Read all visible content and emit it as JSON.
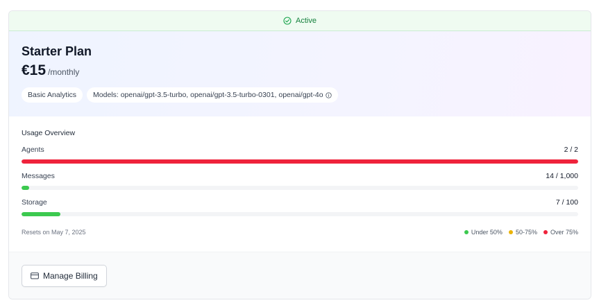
{
  "status": {
    "label": "Active",
    "icon": "check-circle-icon",
    "color": "#16a34a"
  },
  "plan": {
    "name": "Starter Plan",
    "price": "€15",
    "period": "/monthly",
    "features": [
      {
        "label": "Basic Analytics"
      },
      {
        "label": "Models: openai/gpt-3.5-turbo, openai/gpt-3.5-turbo-0301, openai/gpt-4o",
        "icon": "info-icon"
      }
    ]
  },
  "usage": {
    "title": "Usage Overview",
    "meters": [
      {
        "label": "Agents",
        "value": "2 / 2",
        "fraction": 1.0,
        "color": "#ef233c"
      },
      {
        "label": "Messages",
        "value": "14 / 1,000",
        "fraction": 0.014,
        "color": "#3cc94f"
      },
      {
        "label": "Storage",
        "value": "7 / 100",
        "fraction": 0.07,
        "color": "#3cc94f"
      }
    ],
    "reset_text": "Resets on May 7, 2025",
    "legend": [
      {
        "label": "Under 50%",
        "color": "#3cc94f"
      },
      {
        "label": "50-75%",
        "color": "#eab308"
      },
      {
        "label": "Over 75%",
        "color": "#ef233c"
      }
    ]
  },
  "footer": {
    "button_label": "Manage Billing",
    "button_icon": "credit-card-icon"
  }
}
